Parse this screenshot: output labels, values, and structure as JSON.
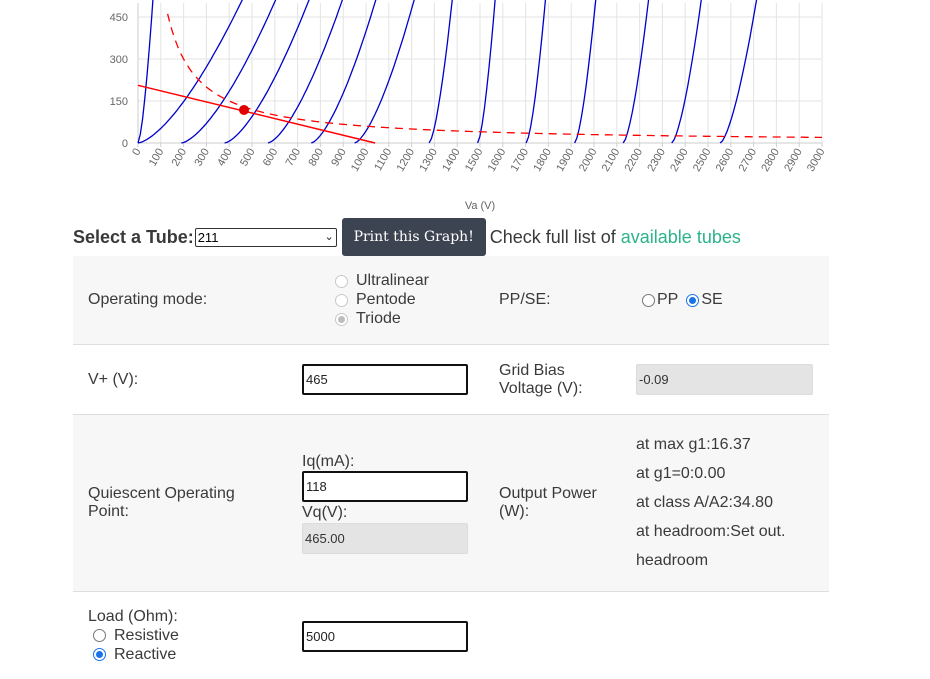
{
  "chart_data": {
    "type": "line",
    "xlabel": "Va (V)",
    "ylabel": "",
    "x_ticks": [
      0,
      100,
      200,
      300,
      400,
      500,
      600,
      700,
      800,
      900,
      1000,
      1100,
      1200,
      1300,
      1400,
      1500,
      1600,
      1700,
      1800,
      1900,
      2000,
      2100,
      2200,
      2300,
      2400,
      2500,
      2600,
      2700,
      2800,
      2900,
      3000
    ],
    "y_ticks_visible": [
      0,
      150,
      300,
      450
    ],
    "xlim": [
      0,
      3000
    ],
    "ylim_visible": [
      0,
      500
    ],
    "grid": true,
    "series": [
      {
        "kind": "plate-curves",
        "color": "#0000cc",
        "offsets": [
          -30,
          -10,
          50,
          170,
          340,
          530,
          760,
          1020,
          1290,
          1570,
          1880,
          2180
        ],
        "x_at_450": [
          60,
          420,
          570,
          720,
          870,
          1020,
          1190,
          1370,
          1560,
          1780,
          2000,
          2230,
          2460,
          2700
        ]
      },
      {
        "kind": "max-dissipation",
        "color": "#ff0000",
        "style": "dashed",
        "watts": 60
      },
      {
        "kind": "load-line",
        "color": "#ff0000",
        "points": [
          [
            0,
            206
          ],
          [
            1040,
            0
          ]
        ]
      },
      {
        "kind": "operating-point",
        "color": "#e00000",
        "x": 465,
        "y": 118
      }
    ]
  },
  "tube": {
    "label": "Select a Tube:",
    "selected": "211",
    "print_button": "Print this Graph!",
    "check_prefix": "Check full list of",
    "check_link": "available tubes"
  },
  "mode": {
    "label": "Operating mode:",
    "options": [
      "Ultralinear",
      "Pentode",
      "Triode"
    ],
    "selected": "Triode"
  },
  "ppse": {
    "label": "PP/SE:",
    "pp": "PP",
    "se": "SE",
    "selected": "SE"
  },
  "vplus": {
    "label": "V+ (V):",
    "value": "465"
  },
  "grid_bias": {
    "label_line1": "Grid Bias",
    "label_line2": "Voltage (V):",
    "value": "-0.09"
  },
  "quiescent": {
    "label_line1": "Quiescent Operating",
    "label_line2": "Point:",
    "iq_label": "Iq(mA):",
    "iq_value": "118",
    "vq_label": "Vq(V):",
    "vq_value": "465.00"
  },
  "output_power": {
    "label_line1": "Output Power",
    "label_line2": "(W):",
    "max_g1": "at max g1:16.37",
    "g1_zero": "at g1=0:0.00",
    "class_a2": "at class A/A2:34.80",
    "headroom": "at headroom:Set out.",
    "headroom2": "headroom"
  },
  "load": {
    "label": "Load (Ohm):",
    "resistive": "Resistive",
    "reactive": "Reactive",
    "selected": "Reactive",
    "value": "5000"
  }
}
